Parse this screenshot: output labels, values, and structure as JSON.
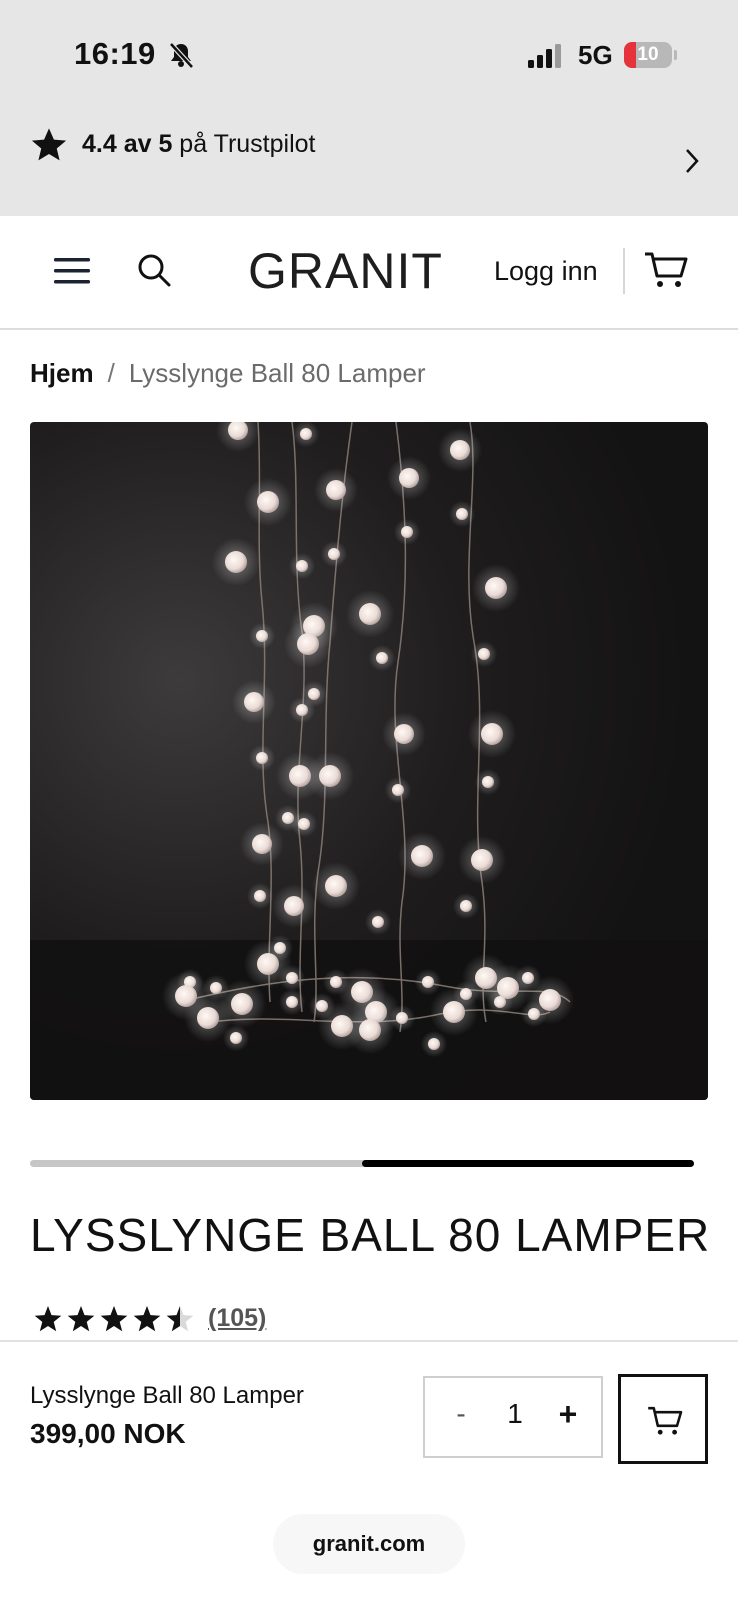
{
  "status_bar": {
    "time": "16:19",
    "network": "5G",
    "battery": "10"
  },
  "trustpilot": {
    "score": "4.4 av 5",
    "suffix": " på Trustpilot"
  },
  "header": {
    "logo": "GRANIT",
    "login_label": "Logg inn"
  },
  "breadcrumb": {
    "home": "Hjem",
    "separator": "/",
    "current": "Lysslynge Ball 80 Lamper"
  },
  "gallery": {
    "progress_start": 0.5,
    "progress_end": 1.0
  },
  "product": {
    "title": "LYSSLYNGE BALL 80 LAMPER",
    "rating": 4.5,
    "review_count": "(105)"
  },
  "purchase_bar": {
    "name": "Lysslynge Ball 80 Lamper",
    "price": "399,00 NOK",
    "minus_label": "-",
    "quantity": "1",
    "plus_label": "+"
  },
  "browser": {
    "url": "granit.com"
  },
  "colors": {
    "top_background": "#e6e6e6",
    "battery_low": "#e5323b",
    "accent": "#111111"
  }
}
